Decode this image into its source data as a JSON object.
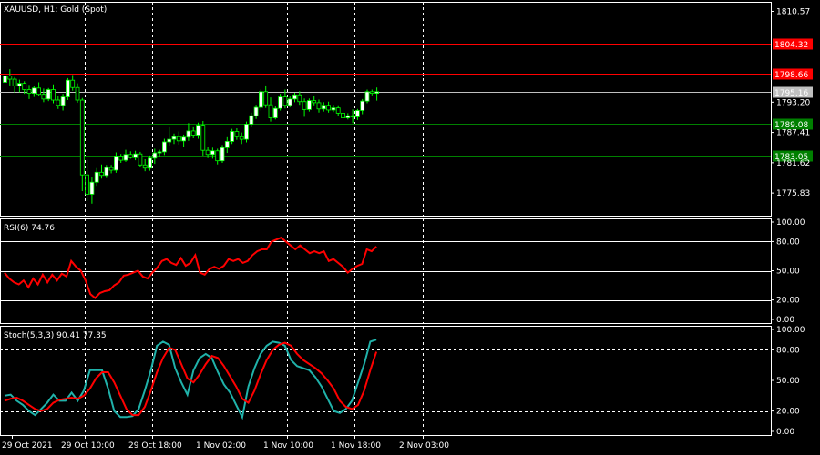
{
  "colors": {
    "background": "#000000",
    "text": "#ffffff",
    "grid": "#ffffff",
    "bull": "#ffffff",
    "bull_outline": "#00ff00",
    "bear": "#000000",
    "bear_outline": "#00ff00",
    "resistance": "#ff0000",
    "support": "#008000",
    "current_line": "#c0c0c0",
    "rsi": "#ff0000",
    "stoch_main": "#20b2aa",
    "stoch_signal": "#ff0000"
  },
  "chart_data": [
    {
      "type": "candlestick",
      "title": "XAUUSD, H1:  Gold (Spot)",
      "y_tick_labels": [
        "1810.57",
        "1793.20",
        "1787.41",
        "1781.62",
        "1775.83"
      ],
      "y_ticks": [
        1810.57,
        1793.2,
        1787.41,
        1781.62,
        1775.83
      ],
      "ylim": [
        1771.5,
        1812.4
      ],
      "x_tick_labels": [
        "29 Oct 2021",
        "29 Oct 10:00",
        "29 Oct 18:00",
        "1 Nov 02:00",
        "1 Nov 10:00",
        "1 Nov 18:00",
        "2 Nov 03:00"
      ],
      "x_tick_bars": [
        0,
        15,
        29,
        43,
        57,
        71,
        85
      ],
      "grid": "dotted vertical",
      "horizontal_levels": [
        {
          "value": 1804.32,
          "label": "1804.32",
          "color": "resistance"
        },
        {
          "value": 1798.66,
          "label": "1798.66",
          "color": "resistance"
        },
        {
          "value": 1795.16,
          "label": "1795.16",
          "color": "current"
        },
        {
          "value": 1789.08,
          "label": "1789.08",
          "color": "support"
        },
        {
          "value": 1783.05,
          "label": "1783.05",
          "color": "support"
        }
      ],
      "ohlc": [
        [
          1797.0,
          1798.9,
          1795.3,
          1798.2
        ],
        [
          1798.2,
          1799.5,
          1796.4,
          1797.6
        ],
        [
          1797.6,
          1798.0,
          1795.0,
          1796.3
        ],
        [
          1796.3,
          1797.5,
          1795.1,
          1796.8
        ],
        [
          1796.8,
          1797.2,
          1794.8,
          1795.6
        ],
        [
          1795.6,
          1796.5,
          1793.8,
          1794.9
        ],
        [
          1794.9,
          1796.3,
          1794.2,
          1795.9
        ],
        [
          1795.9,
          1797.0,
          1794.3,
          1794.7
        ],
        [
          1794.7,
          1795.8,
          1793.2,
          1793.8
        ],
        [
          1793.8,
          1795.9,
          1793.4,
          1795.6
        ],
        [
          1795.6,
          1796.6,
          1793.0,
          1793.6
        ],
        [
          1793.6,
          1794.3,
          1791.9,
          1792.6
        ],
        [
          1792.6,
          1794.8,
          1791.6,
          1794.2
        ],
        [
          1794.2,
          1797.8,
          1793.6,
          1797.4
        ],
        [
          1797.4,
          1798.4,
          1795.4,
          1796.0
        ],
        [
          1796.0,
          1796.8,
          1793.1,
          1793.6
        ],
        [
          1793.6,
          1794.0,
          1776.2,
          1779.3
        ],
        [
          1779.3,
          1782.2,
          1774.3,
          1775.6
        ],
        [
          1775.6,
          1778.8,
          1773.8,
          1777.9
        ],
        [
          1777.9,
          1780.6,
          1777.2,
          1779.8
        ],
        [
          1779.8,
          1781.3,
          1778.6,
          1779.2
        ],
        [
          1779.2,
          1781.2,
          1778.7,
          1780.7
        ],
        [
          1780.7,
          1781.2,
          1779.6,
          1780.2
        ],
        [
          1780.2,
          1783.6,
          1779.7,
          1782.9
        ],
        [
          1782.9,
          1783.3,
          1781.6,
          1782.1
        ],
        [
          1782.1,
          1784.1,
          1781.8,
          1783.2
        ],
        [
          1783.2,
          1783.8,
          1782.4,
          1782.6
        ],
        [
          1782.6,
          1783.9,
          1782.1,
          1783.3
        ],
        [
          1783.3,
          1783.7,
          1780.8,
          1781.2
        ],
        [
          1781.2,
          1782.3,
          1780.0,
          1780.6
        ],
        [
          1780.6,
          1783.0,
          1780.1,
          1782.5
        ],
        [
          1782.5,
          1784.3,
          1781.4,
          1783.5
        ],
        [
          1783.5,
          1784.1,
          1782.8,
          1783.7
        ],
        [
          1783.7,
          1786.2,
          1783.1,
          1785.6
        ],
        [
          1785.6,
          1788.4,
          1784.9,
          1786.1
        ],
        [
          1786.1,
          1787.2,
          1785.2,
          1786.6
        ],
        [
          1786.6,
          1787.6,
          1785.1,
          1785.8
        ],
        [
          1785.8,
          1787.0,
          1784.6,
          1786.5
        ],
        [
          1786.5,
          1789.2,
          1785.8,
          1787.7
        ],
        [
          1787.7,
          1788.4,
          1786.3,
          1786.9
        ],
        [
          1786.9,
          1789.3,
          1786.2,
          1788.8
        ],
        [
          1788.8,
          1789.6,
          1783.0,
          1784.0
        ],
        [
          1784.0,
          1784.6,
          1782.5,
          1783.2
        ],
        [
          1783.2,
          1784.5,
          1782.4,
          1783.9
        ],
        [
          1783.9,
          1784.3,
          1781.3,
          1782.0
        ],
        [
          1782.0,
          1785.0,
          1781.6,
          1784.5
        ],
        [
          1784.5,
          1786.5,
          1783.5,
          1785.7
        ],
        [
          1785.7,
          1788.1,
          1785.2,
          1787.6
        ],
        [
          1787.6,
          1788.2,
          1786.0,
          1786.6
        ],
        [
          1786.6,
          1787.4,
          1785.2,
          1786.1
        ],
        [
          1786.1,
          1789.5,
          1785.5,
          1789.0
        ],
        [
          1789.0,
          1791.2,
          1788.4,
          1790.6
        ],
        [
          1790.6,
          1792.7,
          1790.0,
          1792.2
        ],
        [
          1792.2,
          1795.7,
          1791.6,
          1795.2
        ],
        [
          1795.2,
          1796.4,
          1792.1,
          1792.7
        ],
        [
          1792.7,
          1794.1,
          1789.5,
          1790.2
        ],
        [
          1790.2,
          1792.5,
          1789.9,
          1792.0
        ],
        [
          1792.0,
          1794.8,
          1791.6,
          1794.2
        ],
        [
          1794.2,
          1795.6,
          1792.0,
          1792.6
        ],
        [
          1792.6,
          1794.3,
          1792.2,
          1793.8
        ],
        [
          1793.8,
          1795.0,
          1793.2,
          1794.6
        ],
        [
          1794.6,
          1795.3,
          1792.7,
          1793.3
        ],
        [
          1793.3,
          1793.9,
          1790.4,
          1791.8
        ],
        [
          1791.8,
          1793.9,
          1791.4,
          1793.5
        ],
        [
          1793.5,
          1794.4,
          1792.6,
          1793.1
        ],
        [
          1793.1,
          1793.7,
          1791.2,
          1791.9
        ],
        [
          1791.9,
          1793.2,
          1791.4,
          1792.6
        ],
        [
          1792.6,
          1793.3,
          1791.2,
          1791.7
        ],
        [
          1791.7,
          1792.7,
          1791.3,
          1792.1
        ],
        [
          1792.1,
          1792.6,
          1790.6,
          1791.1
        ],
        [
          1791.1,
          1791.6,
          1789.3,
          1790.2
        ],
        [
          1790.2,
          1791.1,
          1789.9,
          1790.6
        ],
        [
          1790.6,
          1791.8,
          1789.2,
          1790.4
        ],
        [
          1790.4,
          1791.9,
          1789.8,
          1791.6
        ],
        [
          1791.6,
          1793.8,
          1790.9,
          1793.4
        ],
        [
          1793.4,
          1795.6,
          1793.0,
          1795.2
        ],
        [
          1795.2,
          1795.6,
          1794.5,
          1794.9
        ],
        [
          1794.9,
          1796.0,
          1793.5,
          1795.2
        ]
      ]
    },
    {
      "type": "line",
      "title": "RSI(6) 74.76",
      "y_tick_labels": [
        "100.00",
        "80.00",
        "50.00",
        "20.00",
        "0.00"
      ],
      "y_ticks": [
        100,
        80,
        50,
        20,
        0
      ],
      "levels": [
        80,
        50,
        20
      ],
      "ylim": [
        0,
        100
      ],
      "series": [
        {
          "values": [
            48,
            42,
            38,
            36,
            40,
            33,
            42,
            36,
            46,
            38,
            46,
            40,
            47,
            44,
            60,
            54,
            50,
            40,
            26,
            22,
            27,
            29,
            30,
            35,
            38,
            45,
            46,
            48,
            50,
            44,
            42,
            48,
            53,
            60,
            62,
            58,
            56,
            63,
            55,
            58,
            66,
            48,
            46,
            52,
            54,
            52,
            55,
            62,
            60,
            62,
            58,
            60,
            66,
            70,
            72,
            72,
            80,
            82,
            84,
            80,
            76,
            72,
            76,
            72,
            68,
            70,
            68,
            70,
            60,
            62,
            58,
            54,
            48,
            52,
            55,
            57,
            72,
            70,
            75
          ]
        }
      ]
    },
    {
      "type": "line",
      "title": "Stoch(5,3,3) 90.41 77.35",
      "y_tick_labels": [
        "100.00",
        "80.00",
        "50.00",
        "20.00",
        "0.00"
      ],
      "y_ticks": [
        100,
        80,
        50,
        20,
        0
      ],
      "levels": [
        80,
        20
      ],
      "ylim": [
        0,
        100
      ],
      "series": [
        {
          "values": [
            35,
            36,
            30,
            26,
            20,
            16,
            22,
            28,
            36,
            30,
            30,
            38,
            30,
            40,
            60,
            60,
            60,
            42,
            20,
            14,
            14,
            15,
            22,
            40,
            60,
            84,
            88,
            85,
            62,
            48,
            36,
            60,
            72,
            76,
            72,
            58,
            46,
            38,
            26,
            14,
            44,
            62,
            76,
            84,
            88,
            87,
            84,
            70,
            64,
            62,
            60,
            53,
            44,
            32,
            20,
            18,
            22,
            30,
            48,
            66,
            88,
            90
          ]
        },
        {
          "values": [
            30,
            32,
            33,
            30,
            26,
            22,
            20,
            22,
            28,
            31,
            32,
            33,
            32,
            35,
            42,
            52,
            58,
            58,
            48,
            35,
            22,
            16,
            16,
            24,
            40,
            58,
            72,
            82,
            80,
            66,
            52,
            48,
            56,
            66,
            74,
            72,
            64,
            54,
            44,
            32,
            28,
            40,
            56,
            70,
            80,
            85,
            87,
            84,
            76,
            70,
            66,
            62,
            57,
            50,
            42,
            30,
            24,
            22,
            26,
            40,
            60,
            78
          ]
        }
      ]
    }
  ]
}
